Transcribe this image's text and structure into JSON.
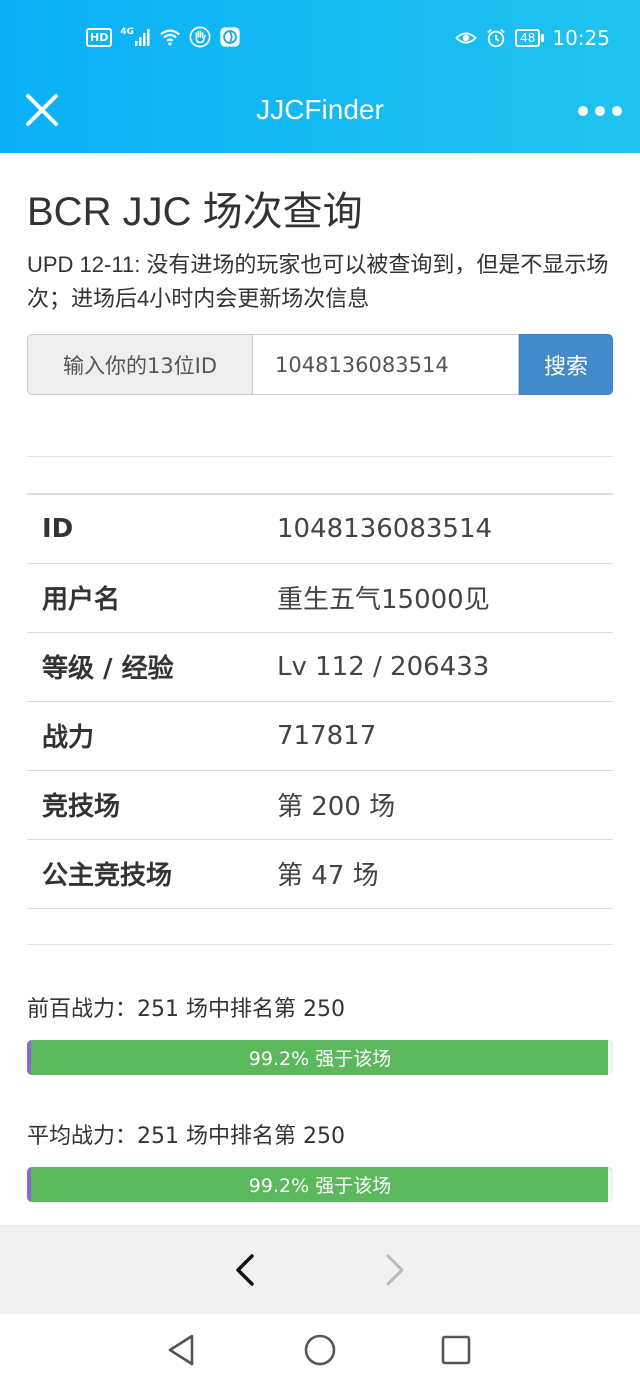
{
  "status_bar": {
    "hd": "HD",
    "network": "4G",
    "battery": "48",
    "time": "10:25",
    "icons": [
      "signal-icon",
      "wifi-icon",
      "hand-icon",
      "browser-icon",
      "eye-icon",
      "alarm-icon",
      "battery-icon"
    ]
  },
  "app_bar": {
    "title": "JJCFinder",
    "close_icon": "close-icon",
    "more_icon": "more-icon"
  },
  "page": {
    "title": "BCR JJC 场次查询",
    "update_note": "UPD 12-11: 没有进场的玩家也可以被查询到，但是不显示场次；进场后4小时内会更新场次信息"
  },
  "search": {
    "addon_label": "输入你的13位ID",
    "value": "1048136083514",
    "button_label": "搜索"
  },
  "info_rows": [
    {
      "label": "ID",
      "value": "1048136083514"
    },
    {
      "label": "用户名",
      "value": "重生五气15000见"
    },
    {
      "label": "等级 / 经验",
      "value": "Lv 112 / 206433"
    },
    {
      "label": "战力",
      "value": "717817"
    },
    {
      "label": "竞技场",
      "value": "第 200 场"
    },
    {
      "label": "公主竞技场",
      "value": "第 47 场"
    }
  ],
  "rankings": [
    {
      "label": "前百战力：251 场中排名第 250",
      "bar_text": "99.2% 强于该场",
      "percent": 99.2
    },
    {
      "label": "平均战力：251 场中排名第 250",
      "bar_text": "99.2% 强于该场",
      "percent": 99.2
    }
  ],
  "colors": {
    "header": "#0ab0f7",
    "primary_button": "#428bca",
    "success_bar": "#5cb85c"
  },
  "browser_nav": {
    "back_icon": "chevron-left-icon",
    "forward_icon": "chevron-right-icon"
  },
  "system_nav": {
    "back": "triangle-back-icon",
    "home": "circle-home-icon",
    "recents": "square-recents-icon"
  }
}
